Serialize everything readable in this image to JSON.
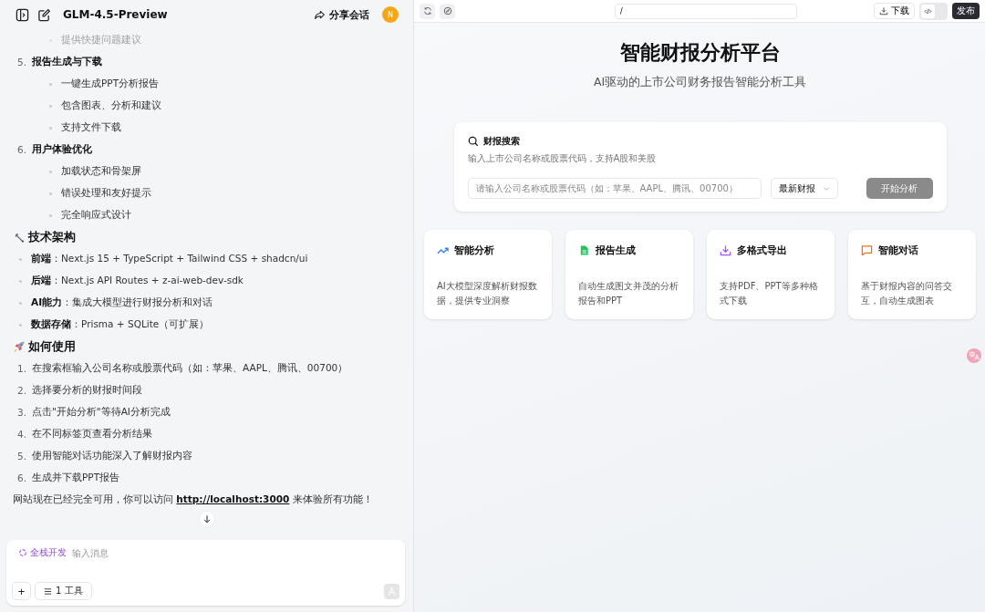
{
  "chat": {
    "title": "GLM-4.5-Preview",
    "share": "分享会话",
    "avatar": "N",
    "lines": [
      {
        "kind": "sub",
        "text": "提供快捷问题建议",
        "faded": true
      },
      {
        "kind": "step",
        "number": "5.",
        "text": "报告生成与下载"
      },
      {
        "kind": "sub",
        "text": "一键生成PPT分析报告",
        "faded": false
      },
      {
        "kind": "sub",
        "text": "包含图表、分析和建议",
        "faded": false
      },
      {
        "kind": "sub",
        "text": "支持文件下载",
        "faded": false
      },
      {
        "kind": "step",
        "number": "6.",
        "text": "用户体验优化"
      },
      {
        "kind": "sub",
        "text": "加载状态和骨架屏",
        "faded": false
      },
      {
        "kind": "sub",
        "text": "错误处理和友好提示",
        "faded": false
      },
      {
        "kind": "sub",
        "text": "完全响应式设计",
        "faded": false
      },
      {
        "kind": "heading",
        "text": "技术架构"
      },
      {
        "kind": "bullet",
        "text": "**前端**：Next.js 15 + TypeScript + Tailwind CSS + shadcn/ui"
      },
      {
        "kind": "bullet",
        "text": "**后端**：Next.js API Routes + z-ai-web-dev-sdk"
      },
      {
        "kind": "bullet",
        "text": "**AI能力**：集成大模型进行财报分析和对话"
      },
      {
        "kind": "bullet",
        "text": "**数据存储**：Prisma + SQLite（可扩展）"
      },
      {
        "kind": "heading",
        "text": "如何使用"
      },
      {
        "kind": "usage",
        "number": "1.",
        "text": "在搜索框输入公司名称或股票代码（如：苹果、AAPL、腾讯、00700）"
      },
      {
        "kind": "usage",
        "number": "2.",
        "text": "选择要分析的财报时间段"
      },
      {
        "kind": "usage",
        "number": "3.",
        "text": "点击\"开始分析\"等待AI分析完成"
      },
      {
        "kind": "usage",
        "number": "4.",
        "text": "在不同标签页查看分析结果"
      },
      {
        "kind": "usage",
        "number": "5.",
        "text": "使用智能对话功能深入了解财报内容"
      },
      {
        "kind": "usage",
        "number": "6.",
        "text": "生成并下载PPT报告"
      },
      {
        "kind": "paragraph",
        "text": "网站现在已经完全可用，你可以访问 ",
        "link": "http://localhost:3000",
        "after": " 来体验所有功能！"
      }
    ]
  },
  "composer": {
    "mode": "全栈开发",
    "placeholder": "输入消息",
    "tools": "1 工具",
    "add": "+"
  },
  "preview": {
    "url": "/",
    "download": "下载",
    "code_view": {
      "on": false
    },
    "publish": "发布",
    "hero": {
      "title": "智能财报分析平台",
      "subtitle": "AI驱动的上市公司财务报告智能分析工具"
    },
    "search": {
      "title": "财报搜索",
      "description": "输入上市公司名称或股票代码，支持A股和美股",
      "placeholder": "请输入公司名称或股票代码（如：苹果、AAPL、腾讯、00700）",
      "period": "最新财报",
      "button": "开始分析",
      "disabled": true
    },
    "features": [
      {
        "title": "智能分析",
        "description": "AI大模型深度解析财报数据，提供专业洞察",
        "color": "#3b82f6"
      },
      {
        "title": "报告生成",
        "description": "自动生成图文并茂的分析报告和PPT",
        "color": "#22c55e"
      },
      {
        "title": "多格式导出",
        "description": "支持PDF、PPT等多种格式下载",
        "color": "#a855f7"
      },
      {
        "title": "智能对话",
        "description": "基于财报内容的问答交互，自动生成图表",
        "color": "#f97316"
      }
    ]
  }
}
